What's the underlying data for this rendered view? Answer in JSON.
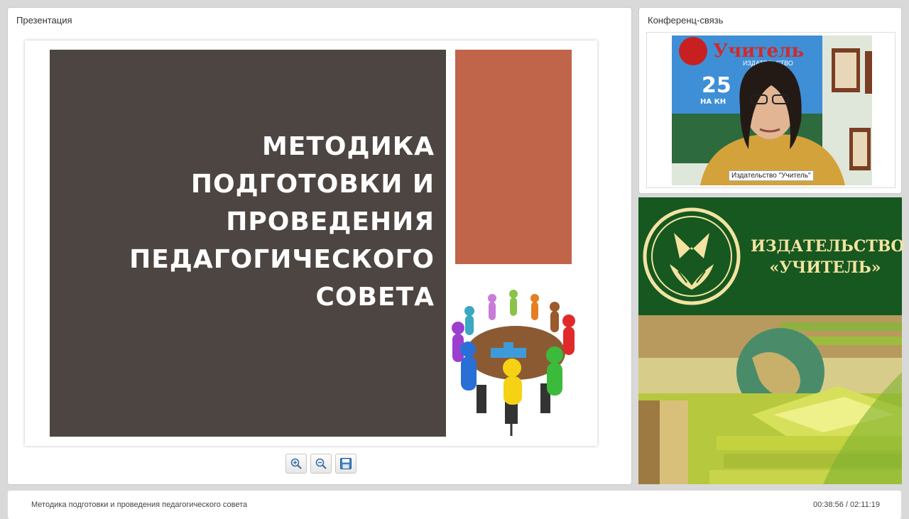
{
  "presentation": {
    "title": "Презентация",
    "slide": {
      "title": "МЕТОДИКА\nПОДГОТОВКИ И\nПРОВЕДЕНИЯ\nПЕДАГОГИЧЕСКОГО\nСОВЕТА",
      "colors": {
        "dark_panel": "#4d4541",
        "accent_block": "#c0644a"
      }
    },
    "toolbar": {
      "zoom_in_icon": "zoom-in-icon",
      "zoom_out_icon": "zoom-out-icon",
      "save_icon": "save-icon"
    }
  },
  "conference": {
    "title": "Конференц-связь",
    "video_caption": "Издательство \"Учитель\"",
    "backdrop_sign": "Учитель",
    "backdrop_subtitle": "ИЗДАТЕЛЬСТВО",
    "backdrop_number": "25",
    "backdrop_text": "НА КН"
  },
  "banner": {
    "publisher": "ИЗДАТЕЛЬСТВО\n«УЧИТЕЛЬ»",
    "colors": {
      "background": "#16581f",
      "text": "#f3e3a2"
    }
  },
  "footer": {
    "title": "Методика подготовки и проведения педагогического совета",
    "time": "00:38:56 / 02:11:19"
  }
}
